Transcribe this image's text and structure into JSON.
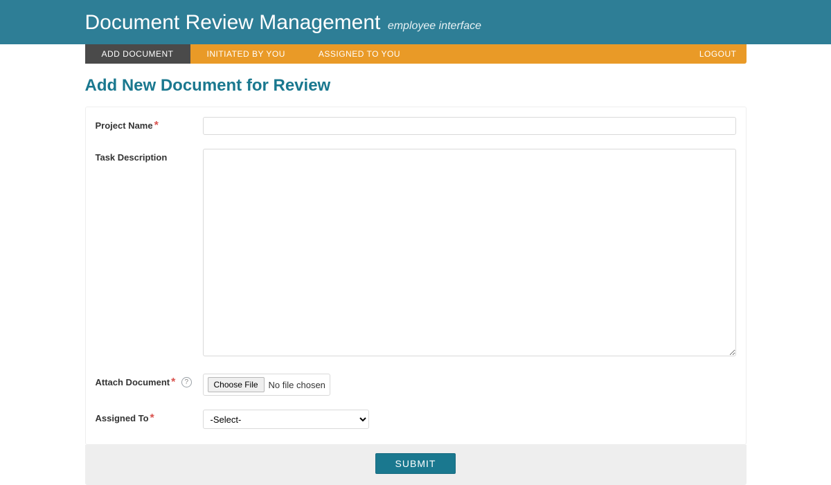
{
  "header": {
    "title": "Document Review Management",
    "subtitle": "employee interface"
  },
  "nav": {
    "items": [
      {
        "label": "ADD DOCUMENT",
        "active": true
      },
      {
        "label": "INITIATED BY YOU",
        "active": false
      },
      {
        "label": "ASSIGNED TO YOU",
        "active": false
      }
    ],
    "logout": "LOGOUT"
  },
  "page": {
    "title": "Add New Document for Review"
  },
  "form": {
    "project_name": {
      "label": "Project Name",
      "required": "*",
      "value": ""
    },
    "task_description": {
      "label": "Task Description",
      "value": ""
    },
    "attach_document": {
      "label": "Attach Document",
      "required": "*",
      "help_text": "?",
      "choose_button": "Choose File",
      "file_status": "No file chosen"
    },
    "assigned_to": {
      "label": "Assigned To",
      "required": "*",
      "selected": "-Select-"
    },
    "submit_label": "SUBMIT"
  }
}
